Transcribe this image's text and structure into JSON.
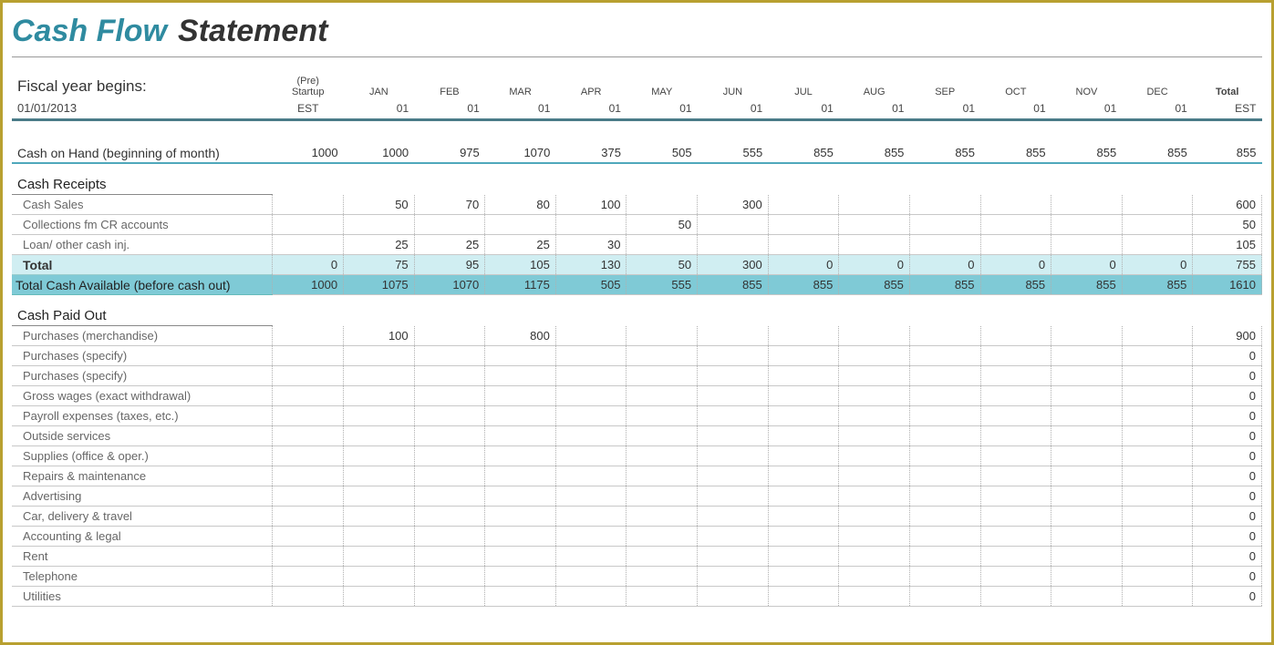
{
  "title": {
    "part1": "Cash Flow",
    "part2": "Statement"
  },
  "fiscal": {
    "label": "Fiscal year begins:",
    "date": "01/01/2013"
  },
  "header": {
    "pre1": "(Pre)",
    "pre2": "Startup",
    "pre3": "EST",
    "months": [
      "JAN",
      "FEB",
      "MAR",
      "APR",
      "MAY",
      "JUN",
      "JUL",
      "AUG",
      "SEP",
      "OCT",
      "NOV",
      "DEC"
    ],
    "sub": "01",
    "total": "Total",
    "total_sub": "EST"
  },
  "cash_on_hand": {
    "label": "Cash on Hand (beginning of month)",
    "values": [
      "1000",
      "1000",
      "975",
      "1070",
      "375",
      "505",
      "555",
      "855",
      "855",
      "855",
      "855",
      "855",
      "855"
    ],
    "total": "855"
  },
  "receipts": {
    "header": "Cash Receipts",
    "rows": [
      {
        "label": "Cash Sales",
        "values": [
          "",
          "50",
          "70",
          "80",
          "100",
          "",
          "300",
          "",
          "",
          "",
          "",
          "",
          ""
        ],
        "total": "600"
      },
      {
        "label": "Collections fm CR accounts",
        "values": [
          "",
          "",
          "",
          "",
          "",
          "50",
          "",
          "",
          "",
          "",
          "",
          "",
          ""
        ],
        "total": "50"
      },
      {
        "label": "Loan/ other cash inj.",
        "values": [
          "",
          "25",
          "25",
          "25",
          "30",
          "",
          "",
          "",
          "",
          "",
          "",
          "",
          ""
        ],
        "total": "105"
      }
    ],
    "subtotal": {
      "label": "Total",
      "values": [
        "0",
        "75",
        "95",
        "105",
        "130",
        "50",
        "300",
        "0",
        "0",
        "0",
        "0",
        "0",
        "0"
      ],
      "total": "755"
    },
    "grand": {
      "label": "Total Cash Available (before cash out)",
      "values": [
        "1000",
        "1075",
        "1070",
        "1175",
        "505",
        "555",
        "855",
        "855",
        "855",
        "855",
        "855",
        "855",
        "855"
      ],
      "total": "1610"
    }
  },
  "paid_out": {
    "header": "Cash Paid Out",
    "rows": [
      {
        "label": "Purchases (merchandise)",
        "values": [
          "",
          "100",
          "",
          "800",
          "",
          "",
          "",
          "",
          "",
          "",
          "",
          "",
          ""
        ],
        "total": "900"
      },
      {
        "label": "Purchases (specify)",
        "values": [
          "",
          "",
          "",
          "",
          "",
          "",
          "",
          "",
          "",
          "",
          "",
          "",
          ""
        ],
        "total": "0"
      },
      {
        "label": "Purchases (specify)",
        "values": [
          "",
          "",
          "",
          "",
          "",
          "",
          "",
          "",
          "",
          "",
          "",
          "",
          ""
        ],
        "total": "0"
      },
      {
        "label": "Gross wages (exact withdrawal)",
        "values": [
          "",
          "",
          "",
          "",
          "",
          "",
          "",
          "",
          "",
          "",
          "",
          "",
          ""
        ],
        "total": "0"
      },
      {
        "label": "Payroll expenses (taxes, etc.)",
        "values": [
          "",
          "",
          "",
          "",
          "",
          "",
          "",
          "",
          "",
          "",
          "",
          "",
          ""
        ],
        "total": "0"
      },
      {
        "label": "Outside services",
        "values": [
          "",
          "",
          "",
          "",
          "",
          "",
          "",
          "",
          "",
          "",
          "",
          "",
          ""
        ],
        "total": "0"
      },
      {
        "label": "Supplies (office & oper.)",
        "values": [
          "",
          "",
          "",
          "",
          "",
          "",
          "",
          "",
          "",
          "",
          "",
          "",
          ""
        ],
        "total": "0"
      },
      {
        "label": "Repairs & maintenance",
        "values": [
          "",
          "",
          "",
          "",
          "",
          "",
          "",
          "",
          "",
          "",
          "",
          "",
          ""
        ],
        "total": "0"
      },
      {
        "label": "Advertising",
        "values": [
          "",
          "",
          "",
          "",
          "",
          "",
          "",
          "",
          "",
          "",
          "",
          "",
          ""
        ],
        "total": "0"
      },
      {
        "label": "Car, delivery & travel",
        "values": [
          "",
          "",
          "",
          "",
          "",
          "",
          "",
          "",
          "",
          "",
          "",
          "",
          ""
        ],
        "total": "0"
      },
      {
        "label": "Accounting & legal",
        "values": [
          "",
          "",
          "",
          "",
          "",
          "",
          "",
          "",
          "",
          "",
          "",
          "",
          ""
        ],
        "total": "0"
      },
      {
        "label": "Rent",
        "values": [
          "",
          "",
          "",
          "",
          "",
          "",
          "",
          "",
          "",
          "",
          "",
          "",
          ""
        ],
        "total": "0"
      },
      {
        "label": "Telephone",
        "values": [
          "",
          "",
          "",
          "",
          "",
          "",
          "",
          "",
          "",
          "",
          "",
          "",
          ""
        ],
        "total": "0"
      },
      {
        "label": "Utilities",
        "values": [
          "",
          "",
          "",
          "",
          "",
          "",
          "",
          "",
          "",
          "",
          "",
          "",
          ""
        ],
        "total": "0"
      }
    ]
  }
}
